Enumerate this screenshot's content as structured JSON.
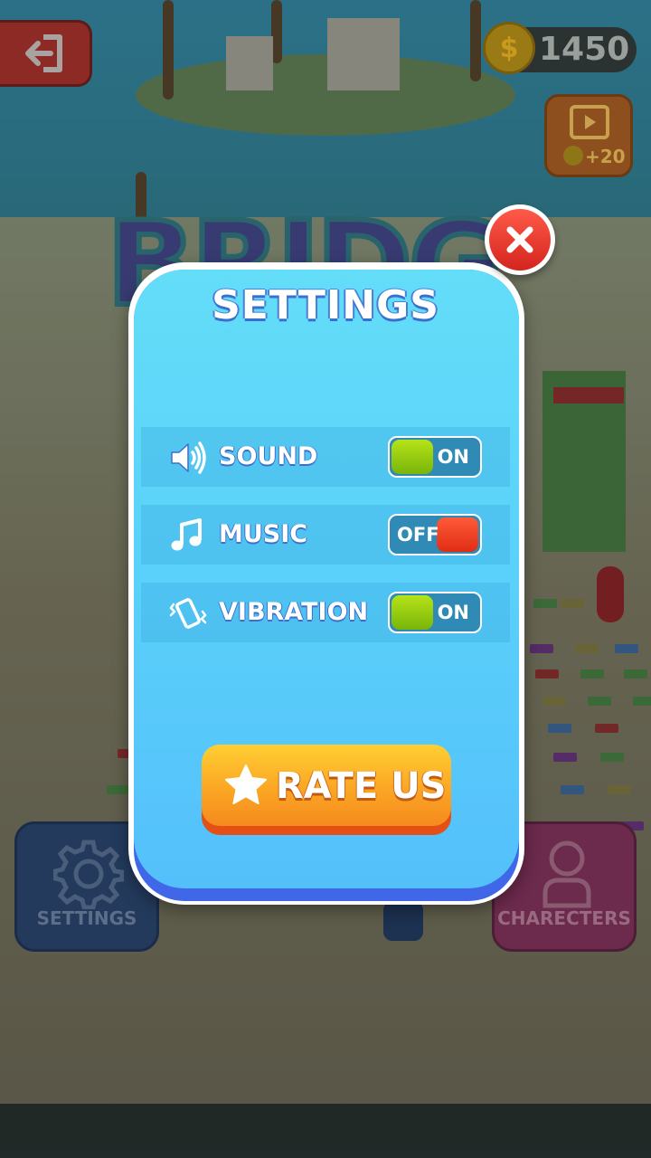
{
  "hud": {
    "coins": "1450",
    "coin_symbol": "$",
    "video_reward": "+20",
    "settings_button_label": "SETTINGS",
    "characters_button_label": "CHARECTERS"
  },
  "background": {
    "logo_text": "BRIDG"
  },
  "settings_modal": {
    "title": "SETTINGS",
    "options": [
      {
        "label": "SOUND",
        "icon": "speaker-icon",
        "state": "ON"
      },
      {
        "label": "MUSIC",
        "icon": "music-note-icon",
        "state": "OFF"
      },
      {
        "label": "VIBRATION",
        "icon": "vibration-icon",
        "state": "ON"
      }
    ],
    "rate_button_label": "RATE US"
  },
  "colors": {
    "modal_top": "#63ddf8",
    "modal_bottom": "#54c0fb",
    "toggle_on": "#9ed010",
    "toggle_off": "#f03e22",
    "rate_button": "#fba624",
    "close_button": "#e8362c"
  }
}
